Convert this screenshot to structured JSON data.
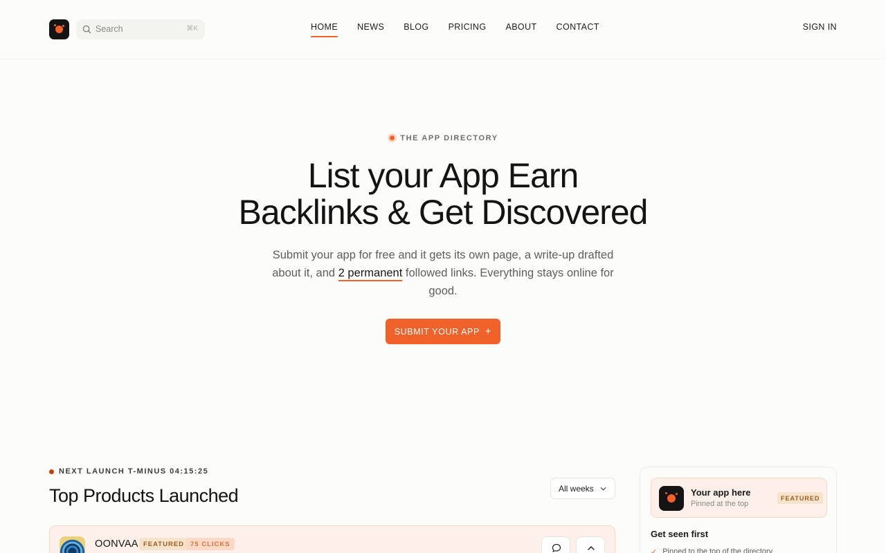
{
  "header": {
    "search_placeholder": "Search",
    "search_shortcut": "⌘K",
    "nav": [
      "HOME",
      "NEWS",
      "BLOG",
      "PRICING",
      "ABOUT",
      "CONTACT"
    ],
    "active_nav": "HOME",
    "signin": "SIGN IN"
  },
  "hero": {
    "eyebrow": "THE APP DIRECTORY",
    "title_line1": "List your App Earn",
    "title_line2": "Backlinks & Get Discovered",
    "sub_before": "Submit your app for free and it gets its own page, a write-up drafted about it, and ",
    "sub_highlight": "2 permanent",
    "sub_after": " followed links. Everything stays online for good.",
    "cta_label": "SUBMIT YOUR APP",
    "cta_icon": "plus-icon"
  },
  "launches": {
    "countdown_label": "NEXT LAUNCH T-MINUS 04:15:25",
    "title": "Top Products Launched",
    "filter_value": "All weeks",
    "products": [
      {
        "name": "OONVAA",
        "badge": "FEATURED",
        "clicks": "75 CLICKS"
      }
    ]
  },
  "sidebar": {
    "promo_title": "Your app here",
    "promo_sub": "Pinned at the top",
    "promo_badge": "FEATURED",
    "seen_title": "Get seen first",
    "seen_items": [
      "Pinned to the top of the directory"
    ]
  },
  "colors": {
    "accent": "#f0622a",
    "background": "#fcfcfa",
    "card_tint": "#fdf0ea"
  }
}
